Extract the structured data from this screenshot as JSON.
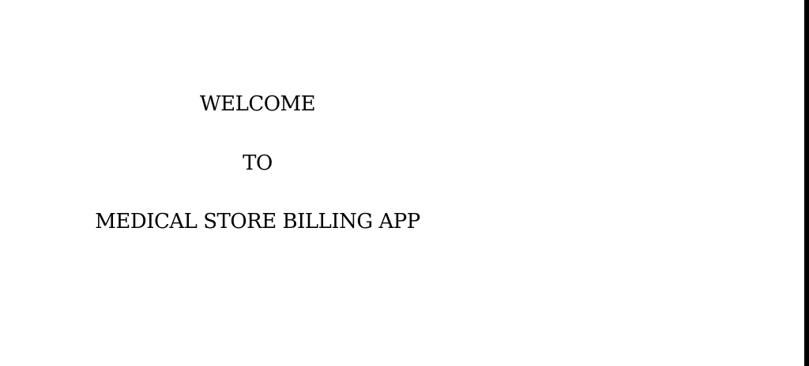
{
  "welcome_screen": {
    "line1": "WELCOME",
    "line2": "TO",
    "line3": "MEDICAL STORE BILLING APP"
  },
  "colors": {
    "background": "#ffffff",
    "text": "#000000",
    "border": "#000000"
  }
}
